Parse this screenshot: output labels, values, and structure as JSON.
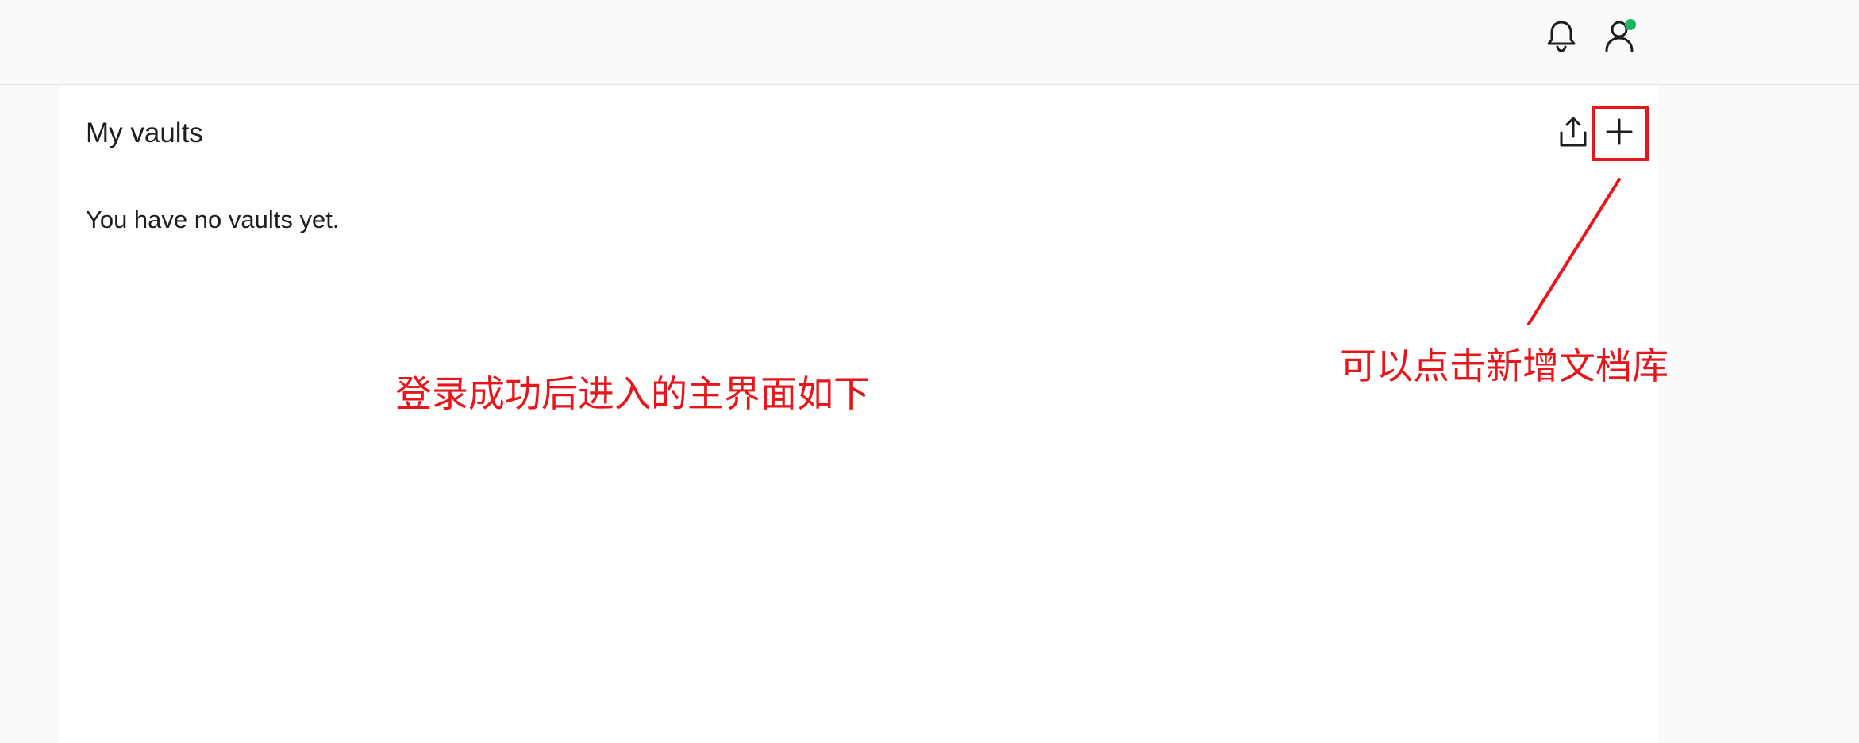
{
  "header": {
    "notifications_icon": "bell-icon",
    "account_icon": "user-icon",
    "account_status_color": "#1cb75b"
  },
  "vaults": {
    "title": "My vaults",
    "empty_message": "You have no vaults yet.",
    "upload_icon": "upload-icon",
    "add_icon": "plus-icon"
  },
  "annotations": {
    "color": "#e8161b",
    "main_note": "登录成功后进入的主界面如下",
    "add_note": "可以点击新增文档库"
  }
}
